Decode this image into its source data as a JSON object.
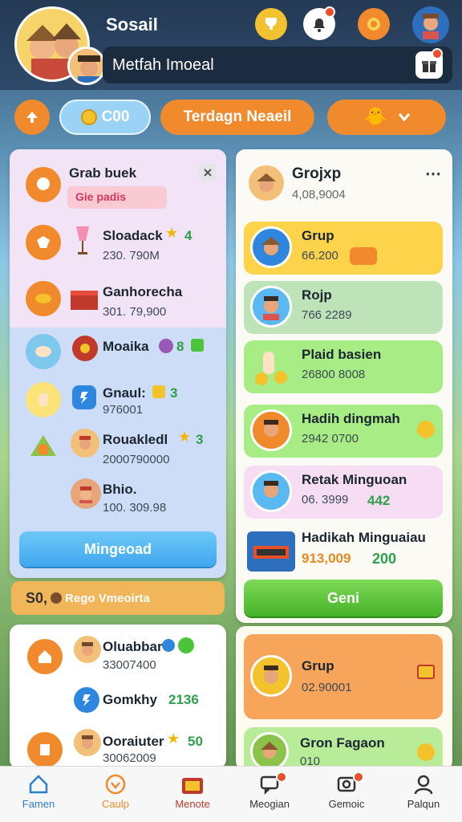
{
  "header": {
    "title": "Sosail",
    "search_text": "Metfah Imoeal"
  },
  "pills": {
    "points_label": "C00",
    "middle_label": "Terdagn Neaeil"
  },
  "left_panel": {
    "title": "Grab buek",
    "tag": "Gie padis",
    "rows": [
      {
        "title": "Sloadack",
        "value": "230. 790M",
        "count": "4"
      },
      {
        "title": "Ganhorecha",
        "value": "301. 79,900"
      },
      {
        "title": "Moaika",
        "count": "8"
      },
      {
        "title": "Gnaul:",
        "value": "976001",
        "count": "3"
      },
      {
        "title": "Rouakledl",
        "value": "2000790000",
        "count": "3"
      },
      {
        "title": "Bhio.",
        "value": "100. 309.98"
      }
    ],
    "button_label": "Mingeoad",
    "footer_value": "S0,",
    "footer_label": "Rego Vmeoirta"
  },
  "right_panel": {
    "title": "Grojxp",
    "subtitle": "4,08,9004",
    "rows": [
      {
        "title": "Grup",
        "value": "66.200",
        "color": "#fcd34a"
      },
      {
        "title": "Rojp",
        "value": "766 2289",
        "color": "#bfe3b9"
      },
      {
        "title": "Plaid basien",
        "value": "26800 8008",
        "color": "#a7ec84"
      },
      {
        "title": "Hadih dingmah",
        "value": "2942 0700",
        "color": "#a7ec84"
      },
      {
        "title": "Retak Minguoan",
        "value": "06. 3999",
        "num": "442",
        "color": "#f6ddf3"
      },
      {
        "title": "Hadikah Minguaiau",
        "value": "913,009",
        "num": "200",
        "color": "#fbfaf5"
      }
    ],
    "button_label": "Geni"
  },
  "bottom_left": {
    "rows": [
      {
        "title": "Oluabbar",
        "value": "33007400"
      },
      {
        "title": "Gomkhy",
        "num": "2136"
      },
      {
        "title": "Ooraiuter",
        "num": "50",
        "value": "30062009"
      }
    ]
  },
  "bottom_right": {
    "rows": [
      {
        "title": "Grup",
        "value": "02.90001"
      },
      {
        "title": "Gron Fagaon",
        "value": "010"
      }
    ]
  },
  "nav": [
    {
      "label": "Famen",
      "icon": "home-icon"
    },
    {
      "label": "Caulp",
      "icon": "heart-icon"
    },
    {
      "label": "Menote",
      "icon": "shop-icon"
    },
    {
      "label": "Meogian",
      "icon": "chat-icon"
    },
    {
      "label": "Gemoic",
      "icon": "camera-icon"
    },
    {
      "label": "Palqun",
      "icon": "profile-icon"
    }
  ],
  "colors": {
    "accent_orange": "#f08a2c",
    "accent_blue": "#5ab8f2",
    "accent_green": "#4cc43a",
    "nav_active": "#2f7ec9"
  }
}
